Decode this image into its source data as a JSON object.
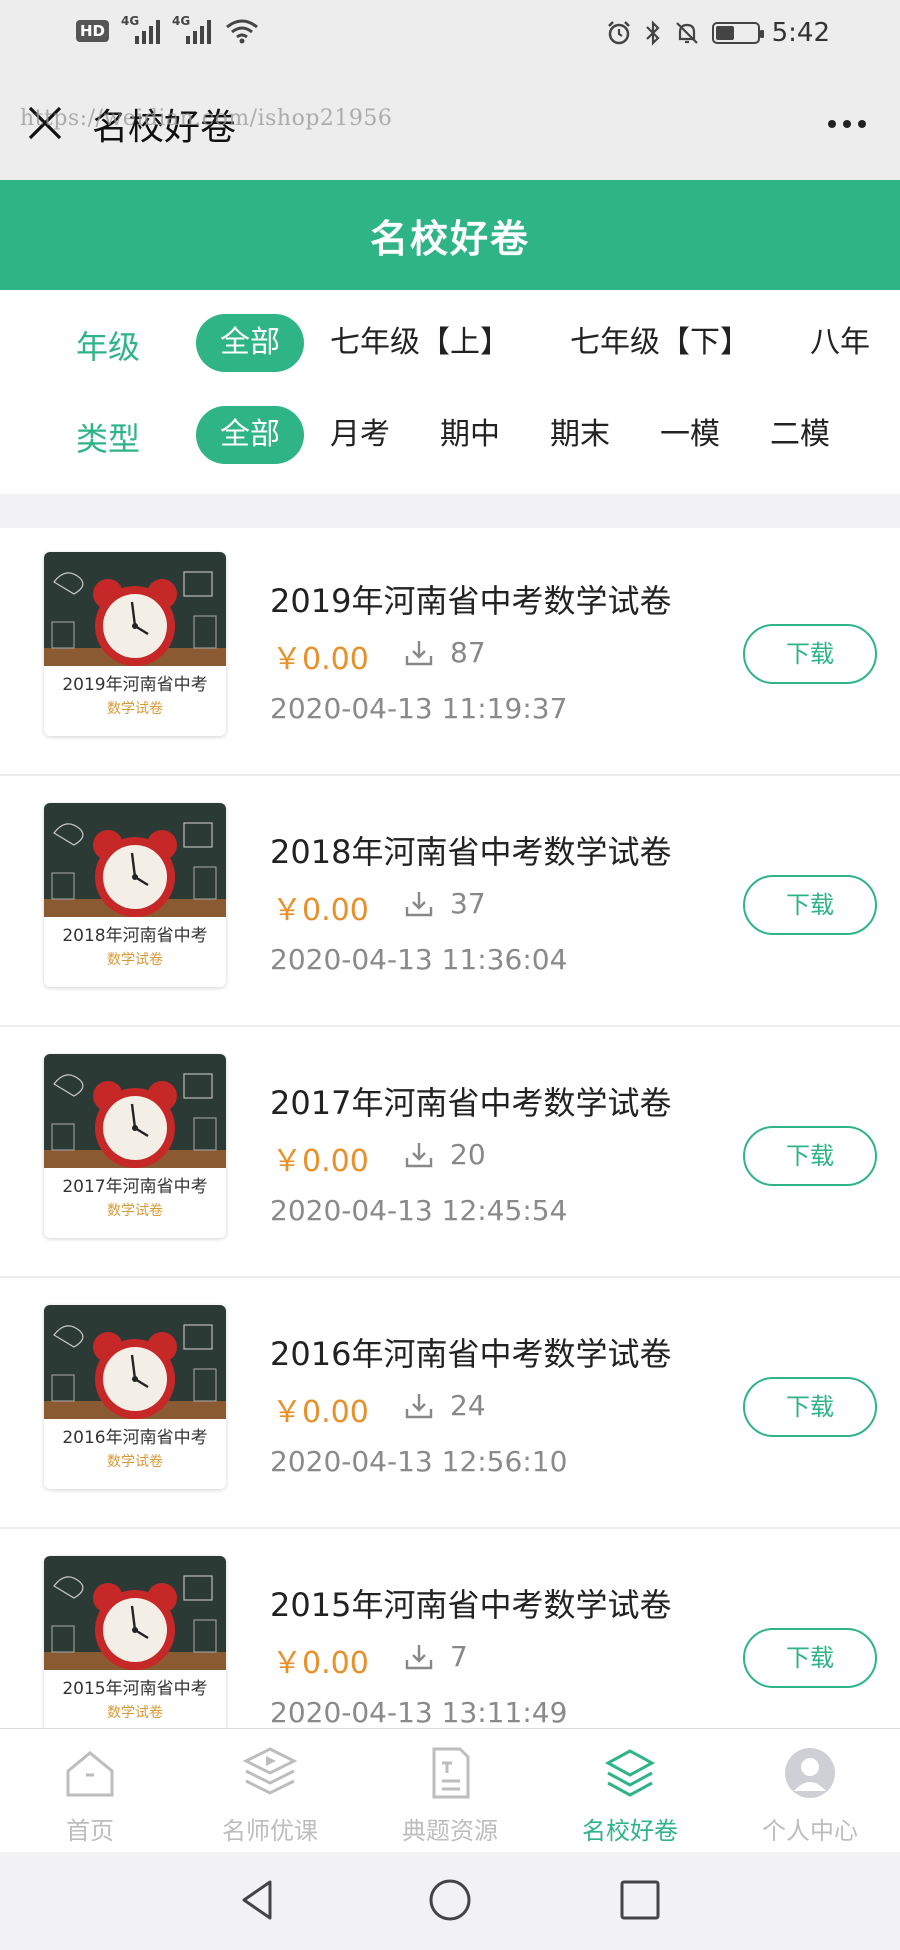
{
  "status_bar": {
    "time": "5:42",
    "network_badge": "HD",
    "network_badge_sub": "2",
    "signal_1": "4G",
    "signal_2": "4G",
    "battery_level": 0.45
  },
  "nav": {
    "title": "名校好卷",
    "watermark": "https://weidian.com/ishop21956"
  },
  "page_header": {
    "title": "名校好卷"
  },
  "filters": {
    "grade_label": "年级",
    "grade_options": [
      "全部",
      "七年级【上】",
      "七年级【下】",
      "八年"
    ],
    "type_label": "类型",
    "type_options": [
      "全部",
      "月考",
      "期中",
      "期末",
      "一模",
      "二模"
    ]
  },
  "papers": [
    {
      "title": "2019年河南省中考数学试卷",
      "thumb_title": "2019年河南省中考",
      "thumb_sub": "数学试卷",
      "price": "￥0.00",
      "downloads": "87",
      "date": "2020-04-13 11:19:37",
      "button": "下载"
    },
    {
      "title": "2018年河南省中考数学试卷",
      "thumb_title": "2018年河南省中考",
      "thumb_sub": "数学试卷",
      "price": "￥0.00",
      "downloads": "37",
      "date": "2020-04-13 11:36:04",
      "button": "下载"
    },
    {
      "title": "2017年河南省中考数学试卷",
      "thumb_title": "2017年河南省中考",
      "thumb_sub": "数学试卷",
      "price": "￥0.00",
      "downloads": "20",
      "date": "2020-04-13 12:45:54",
      "button": "下载"
    },
    {
      "title": "2016年河南省中考数学试卷",
      "thumb_title": "2016年河南省中考",
      "thumb_sub": "数学试卷",
      "price": "￥0.00",
      "downloads": "24",
      "date": "2020-04-13 12:56:10",
      "button": "下载"
    },
    {
      "title": "2015年河南省中考数学试卷",
      "thumb_title": "2015年河南省中考",
      "thumb_sub": "数学试卷",
      "price": "￥0.00",
      "downloads": "7",
      "date": "2020-04-13 13:11:49",
      "button": "下载"
    }
  ],
  "tabs": [
    {
      "label": "首页",
      "icon": "home-icon",
      "active": false
    },
    {
      "label": "名师优课",
      "icon": "video-course-icon",
      "active": false
    },
    {
      "label": "典题资源",
      "icon": "document-icon",
      "active": false
    },
    {
      "label": "名校好卷",
      "icon": "layers-icon",
      "active": true
    },
    {
      "label": "个人中心",
      "icon": "user-icon",
      "active": false
    }
  ],
  "colors": {
    "brand": "#2fb486",
    "price": "#e8902a",
    "tab_inactive": "#bdbdbd"
  }
}
